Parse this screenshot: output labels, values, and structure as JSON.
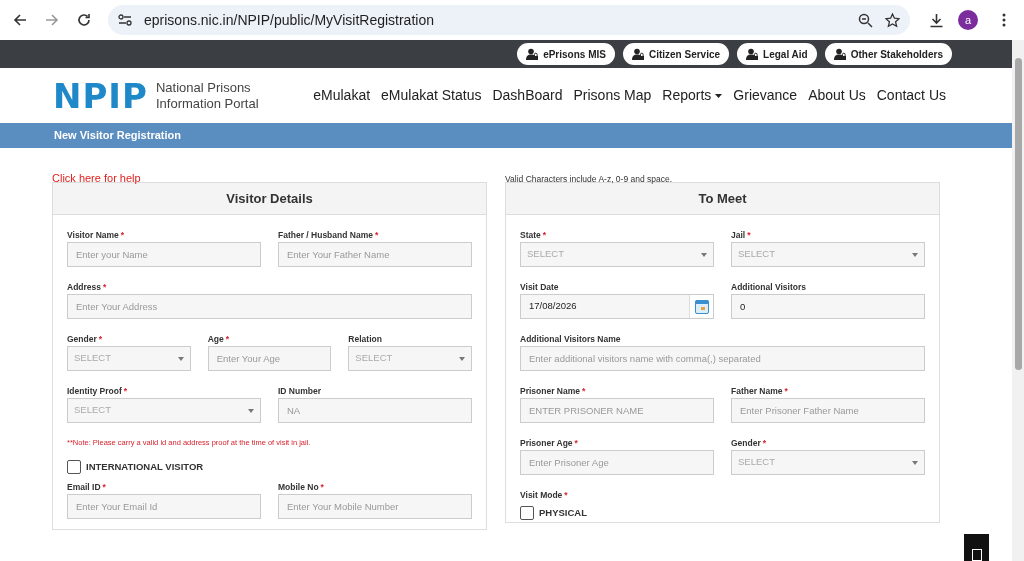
{
  "browser": {
    "url": "eprisons.nic.in/NPIP/public/MyVisitRegistration",
    "profile_initial": "a"
  },
  "top_links": [
    {
      "label": "ePrisons MIS"
    },
    {
      "label": "Citizen Service"
    },
    {
      "label": "Legal Aid"
    },
    {
      "label": "Other Stakeholders"
    }
  ],
  "logo": {
    "mark": "NPIP",
    "line1": "National Prisons",
    "line2": "Information Portal"
  },
  "nav": [
    {
      "label": "eMulakat",
      "kind": "link"
    },
    {
      "label": "eMulakat Status",
      "kind": "link"
    },
    {
      "label": "DashBoard",
      "kind": "link"
    },
    {
      "label": "Prisons Map",
      "kind": "link"
    },
    {
      "label": "Reports",
      "kind": "dropdown"
    },
    {
      "label": "Grievance",
      "kind": "link"
    },
    {
      "label": "About Us",
      "kind": "link"
    },
    {
      "label": "Contact Us",
      "kind": "link"
    }
  ],
  "page_title": "New Visitor Registration",
  "help_link": "Click here for help",
  "valid_chars_note": "Valid Characters include A-z, 0-9 and space.",
  "panels": [
    {
      "title": "Visitor Details",
      "rows": [
        {
          "kind": "fields",
          "fields": [
            {
              "label": "Visitor Name",
              "mark": "*",
              "kind": "text",
              "placeholder": "Enter your Name"
            },
            {
              "label": "Father / Husband Name",
              "mark": "*",
              "kind": "text",
              "placeholder": "Enter Your Father Name"
            }
          ]
        },
        {
          "kind": "fields",
          "fields": [
            {
              "label": "Address",
              "mark": "*",
              "kind": "text",
              "placeholder": "Enter Your Address"
            }
          ]
        },
        {
          "kind": "fields",
          "fields": [
            {
              "label": "Gender",
              "mark": "*",
              "kind": "select",
              "placeholder": "SELECT"
            },
            {
              "label": "Age",
              "mark": "*",
              "kind": "text",
              "placeholder": "Enter Your Age"
            },
            {
              "label": "Relation",
              "kind": "select",
              "placeholder": "SELECT"
            }
          ]
        },
        {
          "kind": "fields",
          "fields": [
            {
              "label": "Identity Proof",
              "mark": "*",
              "kind": "select",
              "placeholder": "SELECT"
            },
            {
              "label": "ID Number",
              "kind": "text",
              "placeholder": "NA"
            }
          ]
        },
        {
          "kind": "note",
          "text": "**Note: Please carry a valid id and address proof at the time of visit in jail."
        },
        {
          "kind": "checkbox",
          "label": "INTERNATIONAL VISITOR",
          "checked": false
        },
        {
          "kind": "fields",
          "fields": [
            {
              "label": "Email ID",
              "mark": "*",
              "kind": "text",
              "placeholder": "Enter Your Email Id"
            },
            {
              "label": "Mobile No",
              "mark": "*",
              "kind": "text",
              "placeholder": "Enter Your Mobile Number"
            }
          ]
        }
      ]
    },
    {
      "title": "To Meet",
      "rows": [
        {
          "kind": "fields",
          "fields": [
            {
              "label": "State",
              "mark": "*",
              "kind": "select",
              "placeholder": "SELECT"
            },
            {
              "label": "Jail",
              "mark": "*",
              "kind": "select",
              "placeholder": "SELECT"
            }
          ]
        },
        {
          "kind": "fields",
          "fields": [
            {
              "label": "Visit Date",
              "kind": "date",
              "value": "17/08/2026"
            },
            {
              "label": "Additional Visitors",
              "kind": "text",
              "value": "0"
            }
          ]
        },
        {
          "kind": "fields",
          "fields": [
            {
              "label": "Additional Visitors Name",
              "kind": "text",
              "placeholder": "Enter additional visitors name with comma(,) separated"
            }
          ]
        },
        {
          "kind": "fields",
          "fields": [
            {
              "label": "Prisoner Name",
              "mark": "*",
              "kind": "text",
              "placeholder": "ENTER PRISONER NAME"
            },
            {
              "label": "Father Name",
              "mark": "*",
              "kind": "text",
              "placeholder": "Enter Prisoner Father Name"
            }
          ]
        },
        {
          "kind": "fields",
          "fields": [
            {
              "label": "Prisoner Age",
              "mark": "*",
              "kind": "text",
              "placeholder": "Enter Prisoner Age"
            },
            {
              "label": "Gender",
              "mark": "*",
              "kind": "select",
              "placeholder": "SELECT"
            }
          ]
        },
        {
          "kind": "label",
          "label": "Visit Mode",
          "mark": "*"
        },
        {
          "kind": "checkbox",
          "label": "PHYSICAL",
          "checked": false
        }
      ]
    }
  ]
}
